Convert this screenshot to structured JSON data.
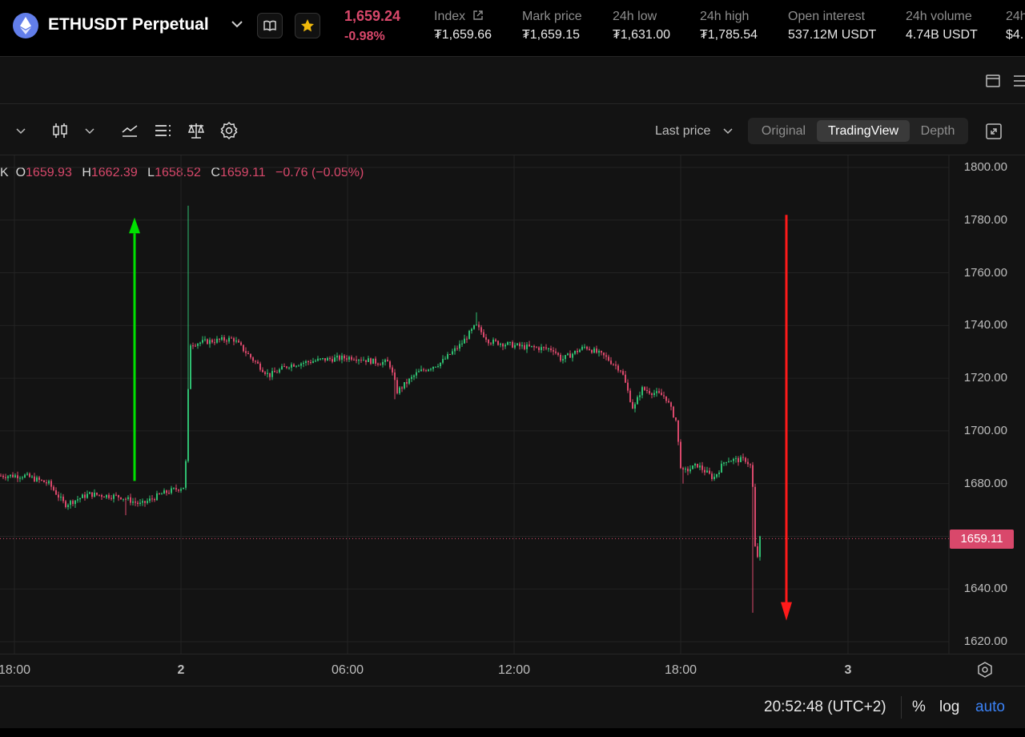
{
  "header": {
    "pair": "ETHUSDT Perpetual",
    "last_price": "1,659.24",
    "change": "-0.98%",
    "stats": [
      {
        "label": "Index",
        "value": "₮1,659.66"
      },
      {
        "label": "Mark price",
        "value": "₮1,659.15"
      },
      {
        "label": "24h low",
        "value": "₮1,631.00"
      },
      {
        "label": "24h high",
        "value": "₮1,785.54"
      },
      {
        "label": "Open interest",
        "value": "537.12M USDT"
      },
      {
        "label": "24h volume",
        "value": "4.74B USDT"
      },
      {
        "label": "24h",
        "value": "$4."
      }
    ]
  },
  "toolbar": {
    "price_mode": "Last price",
    "views": [
      "Original",
      "TradingView",
      "Depth"
    ],
    "active_view": "TradingView"
  },
  "legend": {
    "symbol_tail": "K",
    "o_label": "O",
    "o": "1659.93",
    "h_label": "H",
    "h": "1662.39",
    "l_label": "L",
    "l": "1658.52",
    "c_label": "C",
    "c": "1659.11",
    "change": "−0.76 (−0.05%)"
  },
  "chart_data": {
    "type": "candlestick",
    "y_ticks": [
      "1800.00",
      "1780.00",
      "1760.00",
      "1740.00",
      "1720.00",
      "1700.00",
      "1680.00",
      "1660.00",
      "1640.00",
      "1620.00"
    ],
    "x_ticks": [
      "18:00",
      "2",
      "06:00",
      "12:00",
      "18:00",
      "3"
    ],
    "ylim": [
      1620,
      1800
    ],
    "current_price": "1659.11",
    "colors": {
      "up": "#2fbf71",
      "down": "#d9486b",
      "grid": "#232323",
      "arrow_up": "#00e000",
      "arrow_down": "#ff1a1a"
    },
    "path": [
      {
        "t": 0,
        "p": 1683
      },
      {
        "t": 30,
        "p": 1683
      },
      {
        "t": 60,
        "p": 1680
      },
      {
        "t": 80,
        "p": 1672
      },
      {
        "t": 110,
        "p": 1676
      },
      {
        "t": 150,
        "p": 1675
      },
      {
        "t": 175,
        "p": 1672
      },
      {
        "t": 200,
        "p": 1676
      },
      {
        "t": 230,
        "p": 1679
      },
      {
        "t": 236,
        "p": 1733
      },
      {
        "t": 260,
        "p": 1734
      },
      {
        "t": 290,
        "p": 1735
      },
      {
        "t": 315,
        "p": 1727
      },
      {
        "t": 335,
        "p": 1721
      },
      {
        "t": 360,
        "p": 1725
      },
      {
        "t": 400,
        "p": 1727
      },
      {
        "t": 440,
        "p": 1728
      },
      {
        "t": 470,
        "p": 1726
      },
      {
        "t": 485,
        "p": 1726
      },
      {
        "t": 495,
        "p": 1715
      },
      {
        "t": 520,
        "p": 1722
      },
      {
        "t": 550,
        "p": 1726
      },
      {
        "t": 575,
        "p": 1733
      },
      {
        "t": 593,
        "p": 1740
      },
      {
        "t": 610,
        "p": 1734
      },
      {
        "t": 650,
        "p": 1732
      },
      {
        "t": 690,
        "p": 1731
      },
      {
        "t": 700,
        "p": 1727
      },
      {
        "t": 730,
        "p": 1732
      },
      {
        "t": 755,
        "p": 1728
      },
      {
        "t": 775,
        "p": 1723
      },
      {
        "t": 790,
        "p": 1708
      },
      {
        "t": 800,
        "p": 1716
      },
      {
        "t": 830,
        "p": 1713
      },
      {
        "t": 843,
        "p": 1704
      },
      {
        "t": 850,
        "p": 1684
      },
      {
        "t": 870,
        "p": 1687
      },
      {
        "t": 890,
        "p": 1682
      },
      {
        "t": 905,
        "p": 1689
      },
      {
        "t": 930,
        "p": 1689
      },
      {
        "t": 938,
        "p": 1686
      },
      {
        "t": 943,
        "p": 1648
      },
      {
        "t": 948,
        "p": 1659
      }
    ]
  },
  "footer": {
    "clock": "20:52:48 (UTC+2)",
    "percent": "%",
    "log": "log",
    "auto": "auto"
  }
}
